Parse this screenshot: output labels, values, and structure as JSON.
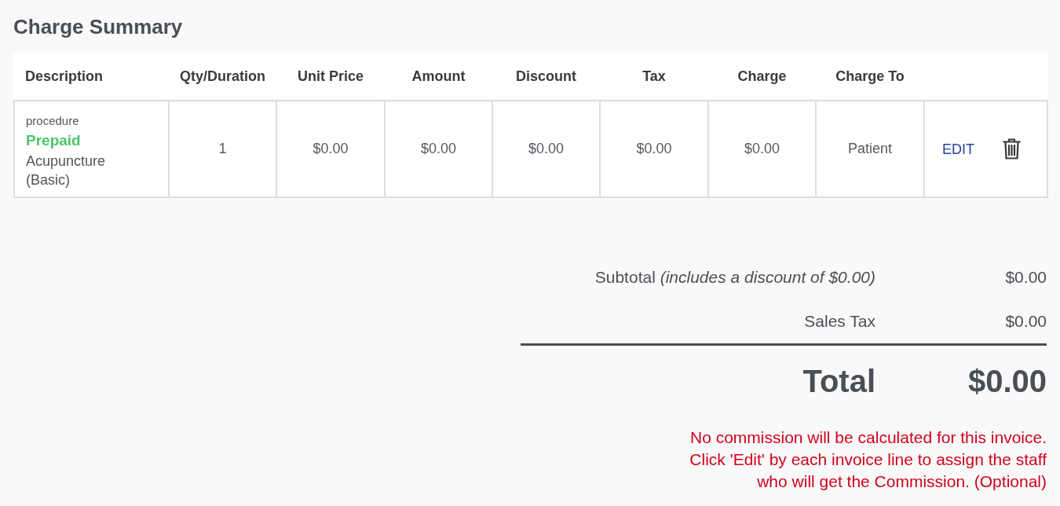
{
  "title": "Charge Summary",
  "table": {
    "columns": [
      "Description",
      "Qty/Duration",
      "Unit Price",
      "Amount",
      "Discount",
      "Tax",
      "Charge",
      "Charge To"
    ],
    "rows": [
      {
        "cells": [
          {
            "category": "procedure",
            "status": "Prepaid",
            "item": "Acupuncture (Basic)"
          },
          "1",
          "$0.00",
          "$0.00",
          "$0.00",
          "$0.00",
          "$0.00",
          "Patient"
        ],
        "action": "EDIT"
      }
    ]
  },
  "summary": {
    "lines": [
      {
        "kind": "subtotal",
        "label": "Subtotal *(includes a discount of $0.00)*",
        "value": "$0.00"
      },
      {
        "kind": "tax",
        "label": "Sales Tax",
        "value": "$0.00"
      },
      {
        "kind": "total",
        "label": "Total",
        "value": "$0.00"
      }
    ],
    "note_lines": [
      "No commission will be calculated for this invoice.",
      "Click 'Edit' by each invoice line to assign the staff",
      "who will get the Commission. (Optional)"
    ]
  }
}
